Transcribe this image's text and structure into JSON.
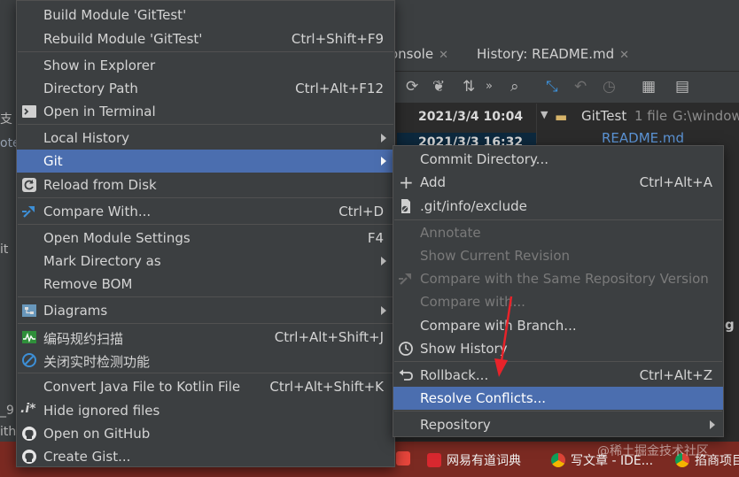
{
  "background": {
    "tabs": [
      {
        "label": "onsole"
      },
      {
        "label": "History: README.md"
      }
    ],
    "toolbar_icons": [
      "refresh-icon",
      "cherry-pick-icon",
      "sort-icon",
      "double-chevron-icon",
      "search-icon",
      "diff-arrow-icon",
      "undo-icon",
      "history-clock-icon",
      "grid-icon",
      "layout-icon"
    ],
    "log_dates": [
      "2021/3/4 10:04",
      "2021/3/3 16:32"
    ],
    "tree": {
      "repo": "GitTest",
      "count": "1 file",
      "path": "G:\\window",
      "file": "README.md"
    },
    "left_fragments": [
      "支",
      "ote",
      "it",
      "_9",
      "ith",
      "ll.."
    ],
    "right_fragment": "g",
    "taskbar": [
      "网易有道词典",
      "写文章 - IDE...",
      "掐商项目"
    ],
    "watermark": "@稀土掘金技术社区"
  },
  "main_menu": {
    "items": [
      {
        "label": "Build Module 'GitTest'",
        "shortcut": ""
      },
      {
        "label": "Rebuild Module 'GitTest'",
        "shortcut": "Ctrl+Shift+F9"
      },
      {
        "label": "Show in Explorer",
        "shortcut": ""
      },
      {
        "label": "Directory Path",
        "shortcut": "Ctrl+Alt+F12"
      },
      {
        "label": "Open in Terminal",
        "shortcut": ""
      },
      {
        "label": "Local History",
        "shortcut": ""
      },
      {
        "label": "Git",
        "shortcut": ""
      },
      {
        "label": "Reload from Disk",
        "shortcut": ""
      },
      {
        "label": "Compare With...",
        "shortcut": "Ctrl+D"
      },
      {
        "label": "Open Module Settings",
        "shortcut": "F4"
      },
      {
        "label": "Mark Directory as",
        "shortcut": ""
      },
      {
        "label": "Remove BOM",
        "shortcut": ""
      },
      {
        "label": "Diagrams",
        "shortcut": ""
      },
      {
        "label": "编码规约扫描",
        "shortcut": "Ctrl+Alt+Shift+J"
      },
      {
        "label": "关闭实时检测功能",
        "shortcut": ""
      },
      {
        "label": "Convert Java File to Kotlin File",
        "shortcut": "Ctrl+Alt+Shift+K"
      },
      {
        "label": "Hide ignored files",
        "shortcut": ""
      },
      {
        "label": "Open on GitHub",
        "shortcut": ""
      },
      {
        "label": "Create Gist...",
        "shortcut": ""
      }
    ]
  },
  "git_menu": {
    "items": [
      {
        "label": "Commit Directory...",
        "shortcut": ""
      },
      {
        "label": "Add",
        "shortcut": "Ctrl+Alt+A"
      },
      {
        "label": ".git/info/exclude",
        "shortcut": ""
      },
      {
        "label": "Annotate",
        "shortcut": ""
      },
      {
        "label": "Show Current Revision",
        "shortcut": ""
      },
      {
        "label": "Compare with the Same Repository Version",
        "shortcut": ""
      },
      {
        "label": "Compare with...",
        "shortcut": ""
      },
      {
        "label": "Compare with Branch...",
        "shortcut": ""
      },
      {
        "label": "Show History",
        "shortcut": ""
      },
      {
        "label": "Rollback...",
        "shortcut": "Ctrl+Alt+Z"
      },
      {
        "label": "Resolve Conflicts...",
        "shortcut": ""
      },
      {
        "label": "Repository",
        "shortcut": ""
      }
    ]
  },
  "colors": {
    "menu_bg": "#3c3f41",
    "selection": "#4b6eaf",
    "annotation_arrow": "#e8232a",
    "taskbar": "#7b2a22"
  }
}
